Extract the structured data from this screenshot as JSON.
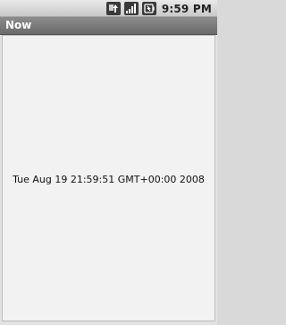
{
  "status_bar": {
    "time": "9:59 PM",
    "icons": [
      "network-activity-icon",
      "signal-strength-icon",
      "battery-icon"
    ]
  },
  "title_bar": {
    "title": "Now"
  },
  "content": {
    "time_button_label": "Tue Aug 19 21:59:51 GMT+00:00 2008"
  },
  "colors": {
    "title_bar": "#7a7a7a",
    "content_background": "#f2f2f2",
    "status_bar": "#d6d6d6"
  }
}
